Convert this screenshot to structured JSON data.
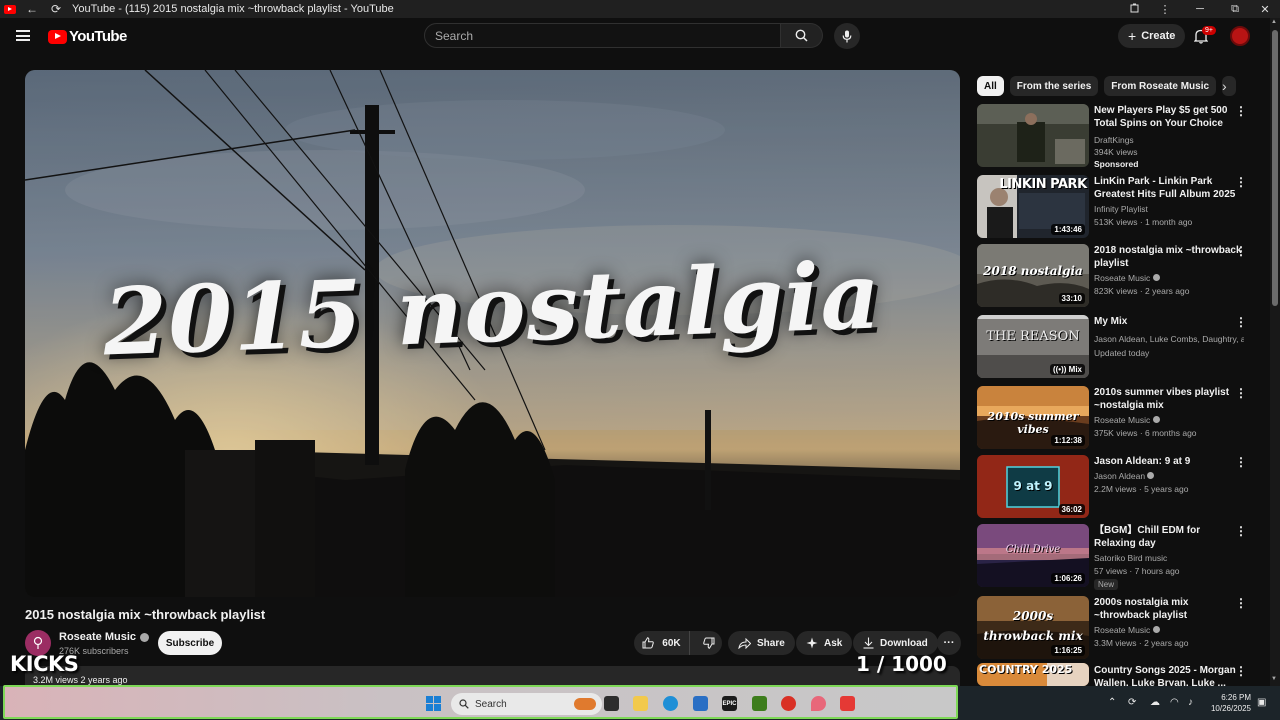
{
  "browser": {
    "title": "YouTube - (115) 2015 nostalgia mix ~throwback playlist - YouTube",
    "back_glyph": "←",
    "reload_glyph": "⟳",
    "menu_glyph": "⋮",
    "minimize_glyph": "─",
    "maximize_glyph": "⧉",
    "close_glyph": "✕"
  },
  "header": {
    "logo_text": "YouTube",
    "search_placeholder": "Search",
    "create_label": "Create",
    "notification_count": "9+"
  },
  "player": {
    "overlay_title": "2015 nostalgia",
    "kicks_watermark": "KICKS",
    "counter": "1  / 1000"
  },
  "video": {
    "title": "2015 nostalgia mix ~throwback playlist",
    "channel": "Roseate Music",
    "subscribers": "276K subscribers",
    "subscribe_label": "Subscribe",
    "likes": "60K",
    "share_label": "Share",
    "ask_label": "Ask",
    "download_label": "Download",
    "more_label": "···",
    "views_line": "3.2M views  2 years ago"
  },
  "chips": [
    "All",
    "From the series",
    "From Roseate Music"
  ],
  "recommendations": [
    {
      "title": "New Players Play $5 get 500 Total Spins on Your Choice Of...",
      "channel": "DraftKings",
      "meta": "394K views",
      "sponsored": "Sponsored",
      "duration": ""
    },
    {
      "title": "LinKin Park - Linkin Park Greatest Hits Full Album 2025 ...",
      "channel": "Infinity Playlist",
      "meta": "513K views · 1 month ago",
      "duration": "1:43:46",
      "thumb_text": "LINKIN PARK"
    },
    {
      "title": "2018 nostalgia mix ~throwback playlist",
      "channel": "Roseate Music",
      "meta": "823K views · 2 years ago",
      "duration": "33:10",
      "thumb_text": "2018 nostalgia"
    },
    {
      "title": "My Mix",
      "channel": "Jason Aldean, Luke Combs, Daughtry, an...",
      "meta": "Updated today",
      "duration": "Mix",
      "thumb_text": "THE REASON"
    },
    {
      "title": "2010s summer vibes playlist ~nostalgia mix",
      "channel": "Roseate Music",
      "meta": "375K views · 6 months ago",
      "duration": "1:12:38",
      "thumb_text": "2010s summer vibes"
    },
    {
      "title": "Jason Aldean: 9 at 9",
      "channel": "Jason Aldean",
      "meta": "2.2M views · 5 years ago",
      "duration": "36:02",
      "thumb_text": "9 at 9"
    },
    {
      "title": "【BGM】Chill EDM for Relaxing day",
      "channel": "Satoriko Bird music",
      "meta": "57 views · 7 hours ago",
      "tag": "New",
      "duration": "1:06:26",
      "thumb_text": "Chill Drive"
    },
    {
      "title": "2000s nostalgia mix ~throwback playlist",
      "channel": "Roseate Music",
      "meta": "3.3M views · 2 years ago",
      "duration": "1:16:25",
      "thumb_text": "2000s throwback mix"
    },
    {
      "title": "Country Songs 2025 - Morgan Wallen, Luke Bryan, Luke ...",
      "channel": "",
      "meta": "",
      "duration": "",
      "thumb_text": "COUNTRY 2025"
    }
  ],
  "taskbar": {
    "search_label": "Search",
    "time": "6:26 PM",
    "date": "10/26/2025"
  }
}
